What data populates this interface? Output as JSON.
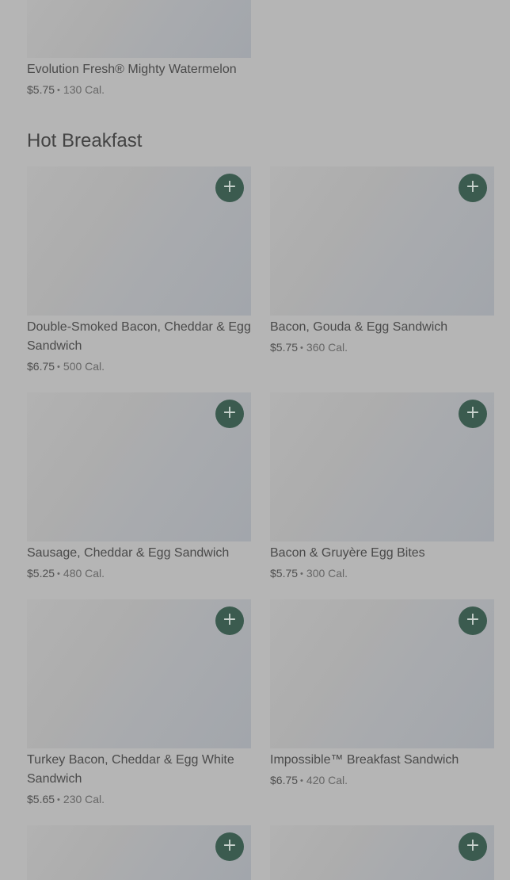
{
  "top_item": {
    "name": "Evolution Fresh® Mighty Watermelon",
    "price": "$5.75",
    "calories": "130 Cal."
  },
  "section": {
    "title": "Hot Breakfast",
    "add_label": "+",
    "items": [
      {
        "name": "Double-Smoked Bacon, Cheddar & Egg Sandwich",
        "price": "$6.75",
        "calories": "500 Cal."
      },
      {
        "name": "Bacon, Gouda & Egg Sandwich",
        "price": "$5.75",
        "calories": "360 Cal."
      },
      {
        "name": "Sausage, Cheddar & Egg Sandwich",
        "price": "$5.25",
        "calories": "480 Cal."
      },
      {
        "name": "Bacon & Gruyère Egg Bites",
        "price": "$5.75",
        "calories": "300 Cal."
      },
      {
        "name": "Turkey Bacon, Cheddar & Egg White Sandwich",
        "price": "$5.65",
        "calories": "230 Cal."
      },
      {
        "name": "Impossible™ Breakfast Sandwich",
        "price": "$6.75",
        "calories": "420 Cal."
      }
    ]
  },
  "separator": "•",
  "colors": {
    "overlay_background": "#b5b5b5",
    "add_button": "#3b5b4f",
    "text": "#4a4a4a"
  }
}
